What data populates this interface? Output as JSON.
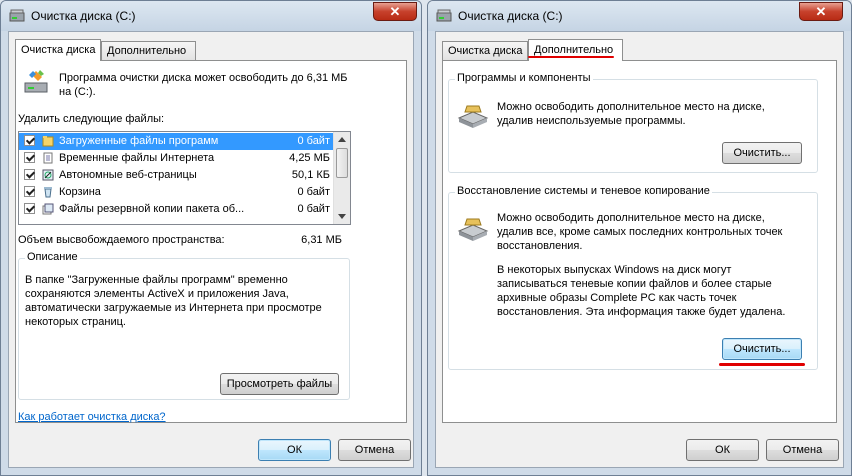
{
  "left_window": {
    "title": "Очистка диска  (C:)",
    "close_label": "✕",
    "tabs": [
      {
        "label": "Очистка диска"
      },
      {
        "label": "Дополнительно"
      }
    ],
    "intro": "Программа очистки диска может освободить до 6,31 МБ на  (C:).",
    "files_label": "Удалить следующие файлы:",
    "files": [
      {
        "name": "Загруженные файлы программ",
        "size": "0 байт",
        "checked": true,
        "selected": true,
        "icon": "folder-icon"
      },
      {
        "name": "Временные файлы Интернета",
        "size": "4,25 МБ",
        "checked": true,
        "selected": false,
        "icon": "document-icon"
      },
      {
        "name": "Автономные веб-страницы",
        "size": "50,1 КБ",
        "checked": true,
        "selected": false,
        "icon": "offline-page-icon"
      },
      {
        "name": "Корзина",
        "size": "0 байт",
        "checked": true,
        "selected": false,
        "icon": "recycle-bin-icon"
      },
      {
        "name": "Файлы резервной копии пакета об...",
        "size": "0 байт",
        "checked": true,
        "selected": false,
        "icon": "backup-files-icon"
      }
    ],
    "space_label": "Объем высвобождаемого пространства:",
    "space_value": "6,31 МБ",
    "description_title": "Описание",
    "description_text": "В папке \"Загруженные файлы программ\" временно сохраняются элементы ActiveX и приложения Java, автоматически загружаемые из Интернета при просмотре некоторых страниц.",
    "view_files_button": "Просмотреть файлы",
    "help_link": "Как работает очистка диска?",
    "ok_button": "ОК",
    "cancel_button": "Отмена"
  },
  "right_window": {
    "title": "Очистка диска  (C:)",
    "close_label": "✕",
    "tabs": [
      {
        "label": "Очистка диска"
      },
      {
        "label": "Дополнительно"
      }
    ],
    "programs_group": {
      "title": "Программы и компоненты",
      "text": "Можно освободить дополнительное место на диске, удалив неиспользуемые программы.",
      "button": "Очистить..."
    },
    "restore_group": {
      "title": "Восстановление системы и теневое копирование",
      "text1": "Можно освободить дополнительное место на диске, удалив все, кроме самых последних контрольных точек восстановления.",
      "text2": "В некоторых выпусках Windows на диск могут записываться теневые копии файлов и более старые архивные образы Complete PC как часть точек восстановления. Эта информация также будет удалена.",
      "button": "Очистить..."
    },
    "ok_button": "ОК",
    "cancel_button": "Отмена"
  },
  "colors": {
    "selection": "#3399ff",
    "highlight_underline": "#e00000",
    "link": "#0066cc"
  }
}
